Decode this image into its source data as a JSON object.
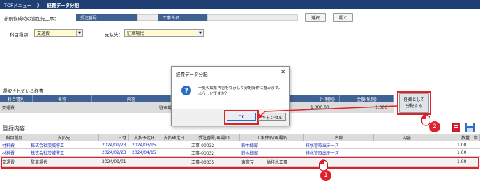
{
  "topbar": {
    "menu": "TOPメニュー",
    "separator": "》",
    "current": "経費データ分配"
  },
  "header": {
    "target_label": "新規作成時の追加先工事：",
    "order_no_header": "受注番号",
    "construction_name_header": "工事件名",
    "select_button": "選択",
    "open_button": "開く",
    "category_label": "科目種別：",
    "category_value": "交通費",
    "payee_label": "支払先：",
    "payee_value": "駐車場代"
  },
  "selected": {
    "title": "選択されている経費",
    "columns": [
      "科目種別",
      "名称",
      "内容",
      "計(税別)",
      "金額(税別)"
    ],
    "row": {
      "category": "交通費",
      "content": "駐車場",
      "amount1": "1,000.00",
      "amount2": "1,000"
    },
    "distribute_button_line1": "経費として",
    "distribute_button_line2": "分配する"
  },
  "registration": {
    "title": "登録内容",
    "columns": [
      "科目種別",
      "支払先",
      "日付",
      "支払予定日",
      "支払確定日",
      "受注番号/現場ID",
      "工事件名/現場名",
      "名称",
      "内容",
      "数量",
      "単"
    ],
    "rows": [
      {
        "category": "材料費",
        "payee": "株式会社茨城警工",
        "date": "2024/01/23",
        "pay_plan": "2024/03/15",
        "pay_confirm": "",
        "order_no": "工事-00032",
        "site": "鈴木様邸",
        "name": "排水管取出チーズ",
        "content": "",
        "qty": "1.00"
      },
      {
        "category": "材料費",
        "payee": "株式会社茨城警工",
        "date": "2024/02/23",
        "pay_plan": "2024/04/15",
        "pay_confirm": "",
        "order_no": "工事-00032",
        "site": "鈴木様邸",
        "name": "排水管取出チーズ",
        "content": "",
        "qty": "1.00"
      },
      {
        "category": "交通費",
        "payee": "駐車場代",
        "date": "2024/09/01",
        "pay_plan": "",
        "pay_confirm": "",
        "order_no": "工事-00035",
        "site": "東京マート　給排水工事",
        "name": "",
        "content": "",
        "qty": "1.00"
      }
    ]
  },
  "dialog": {
    "title": "経費データ分配",
    "close": "✕",
    "message_line1": "一覧の編集内容を保存して分配操作に進みます。",
    "message_line2": "よろしいですか？",
    "ok": "OK",
    "cancel": "キャンセル",
    "icon": "question-icon"
  },
  "annotations": {
    "marker1": "1",
    "marker2": "2"
  },
  "colors": {
    "header_blue": "#3f6193",
    "topbar": "#1f3f74",
    "highlight_red": "#e0202a",
    "link_blue": "#2431b8"
  }
}
